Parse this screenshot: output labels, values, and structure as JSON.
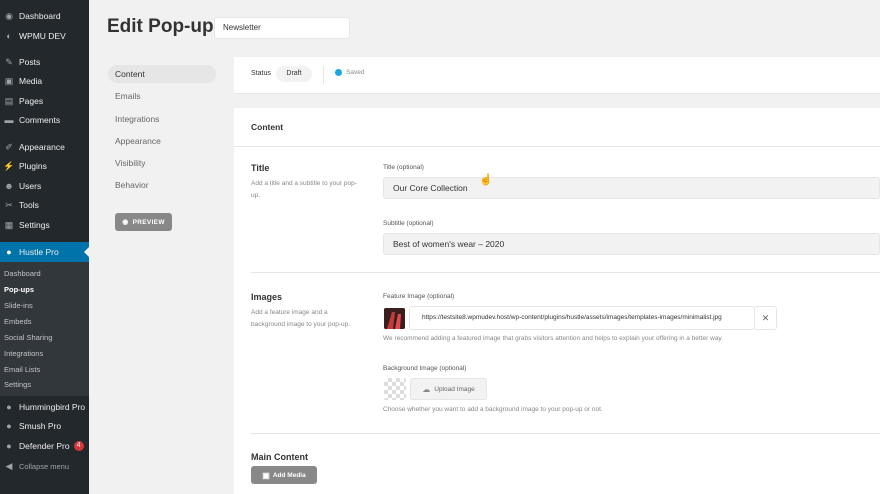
{
  "wp_menu": {
    "items": [
      {
        "label": "Dashboard",
        "icon": "dashboard-icon",
        "glyph": "◉"
      },
      {
        "label": "WPMU DEV",
        "icon": "wpmudev-icon",
        "glyph": "◐"
      },
      {
        "label": "Posts",
        "icon": "pin-icon",
        "glyph": "✎"
      },
      {
        "label": "Media",
        "icon": "media-icon",
        "glyph": "▣"
      },
      {
        "label": "Pages",
        "icon": "pages-icon",
        "glyph": "▤"
      },
      {
        "label": "Comments",
        "icon": "comments-icon",
        "glyph": "▬"
      },
      {
        "label": "Appearance",
        "icon": "appearance-icon",
        "glyph": "✐"
      },
      {
        "label": "Plugins",
        "icon": "plugins-icon",
        "glyph": "⚡"
      },
      {
        "label": "Users",
        "icon": "users-icon",
        "glyph": "☻"
      },
      {
        "label": "Tools",
        "icon": "tools-icon",
        "glyph": "✂"
      },
      {
        "label": "Settings",
        "icon": "settings-icon",
        "glyph": "▦"
      },
      {
        "label": "Hustle Pro",
        "icon": "hustle-icon",
        "glyph": "●"
      }
    ],
    "submenu": [
      "Dashboard",
      "Pop-ups",
      "Slide-ins",
      "Embeds",
      "Social Sharing",
      "Integrations",
      "Email Lists",
      "Settings"
    ],
    "submenu_current": "Pop-ups",
    "bottom_items": [
      {
        "label": "Hummingbird Pro",
        "icon": "hummingbird-icon",
        "glyph": "●"
      },
      {
        "label": "Smush Pro",
        "icon": "smush-icon",
        "glyph": "●"
      },
      {
        "label": "Defender Pro",
        "icon": "defender-icon",
        "glyph": "●",
        "badge": "4"
      },
      {
        "label": "Collapse menu",
        "icon": "collapse-icon",
        "glyph": "◀"
      }
    ]
  },
  "header": {
    "title": "Edit Pop-up",
    "name_value": "Newsletter"
  },
  "tabs": [
    "Content",
    "Emails",
    "Integrations",
    "Appearance",
    "Visibility",
    "Behavior"
  ],
  "active_tab": "Content",
  "preview_label": "PREVIEW",
  "status": {
    "label": "Status",
    "value": "Draft",
    "saved": "Saved"
  },
  "content": {
    "card_title": "Content",
    "title_section": {
      "heading": "Title",
      "description": "Add a title and a subtitle to your pop-up.",
      "title_label": "Title (optional)",
      "title_value": "Our Core Collection",
      "subtitle_label": "Subtitle (optional)",
      "subtitle_value": "Best of women's wear – 2020"
    },
    "images_section": {
      "heading": "Images",
      "description": "Add a feature image and a background image to your pop-up.",
      "feature_label": "Feature Image (optional)",
      "feature_url": "https://testsite8.wpmudev.host/wp-content/plugins/hustle/assets/images/templates-images/minimalist.jpg",
      "feature_help": "We recommend adding a featured image that grabs visitors attention and helps to explain your offering in a better way.",
      "background_label": "Background Image (optional)",
      "upload_label": "Upload Image",
      "background_help": "Choose whether you want to add a background image to your pop-up or not."
    },
    "main_content": {
      "heading": "Main Content",
      "add_media_label": "Add Media"
    }
  },
  "colors": {
    "sidebar_bg": "#23282d",
    "sidebar_active": "#0073aa",
    "page_bg": "#f1f1f1",
    "button_gray": "#888888",
    "saved_dot": "#17a8e3"
  }
}
